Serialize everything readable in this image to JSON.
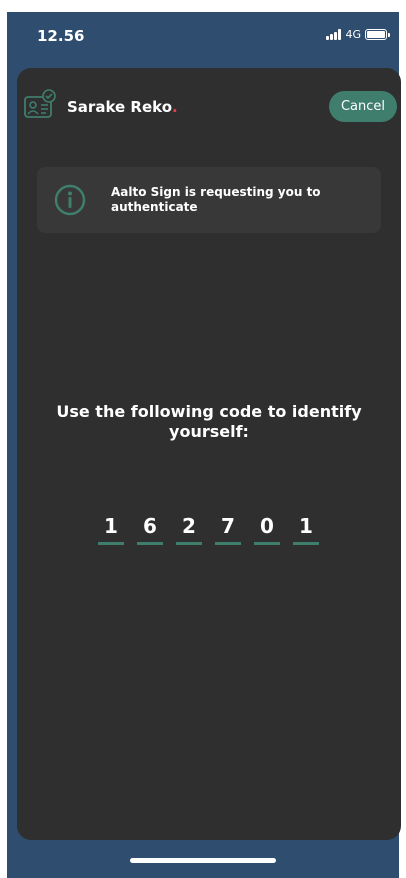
{
  "status_bar": {
    "time": "12.56",
    "network": "4G"
  },
  "header": {
    "app_name": "Sarake Reko",
    "app_name_dot": ".",
    "cancel_label": "Cancel"
  },
  "info": {
    "message": "Aalto Sign is requesting you to authenticate"
  },
  "prompt": "Use the following code to identify yourself:",
  "code": [
    "1",
    "6",
    "2",
    "7",
    "0",
    "1"
  ],
  "colors": {
    "background": "#2f4d6e",
    "card": "#2f2f2f",
    "accent": "#3f7d6c",
    "brand_dot": "#e0424a"
  },
  "icons": {
    "logo": "id-card-check-icon",
    "info": "info-circle-icon"
  }
}
